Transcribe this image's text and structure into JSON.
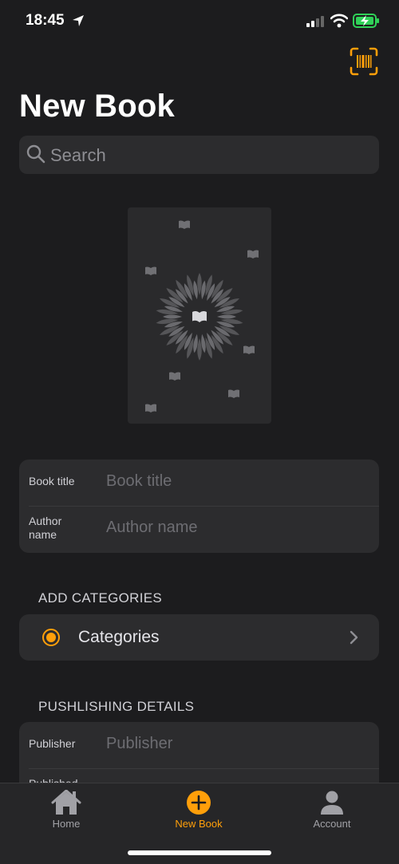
{
  "status_bar": {
    "time": "18:45"
  },
  "header": {
    "title": "New Book"
  },
  "search": {
    "placeholder": "Search"
  },
  "book_fields": [
    {
      "label": "Book title",
      "placeholder": "Book title"
    },
    {
      "label": "Author name",
      "placeholder": "Author name"
    }
  ],
  "categories_section": {
    "header": "ADD CATEGORIES",
    "label": "Categories"
  },
  "publishing_section": {
    "header": "PUSHLISHING DETAILS",
    "fields": [
      {
        "label": "Publisher",
        "placeholder": "Publisher"
      },
      {
        "label": "Published"
      }
    ]
  },
  "tabbar": {
    "tabs": [
      {
        "label": "Home",
        "icon": "house-icon"
      },
      {
        "label": "New Book",
        "icon": "plus-circle-icon",
        "active": true
      },
      {
        "label": "Account",
        "icon": "person-icon"
      }
    ]
  },
  "colors": {
    "accent": "#ff9f0a",
    "background": "#1c1c1e",
    "card": "#2c2c2e"
  }
}
